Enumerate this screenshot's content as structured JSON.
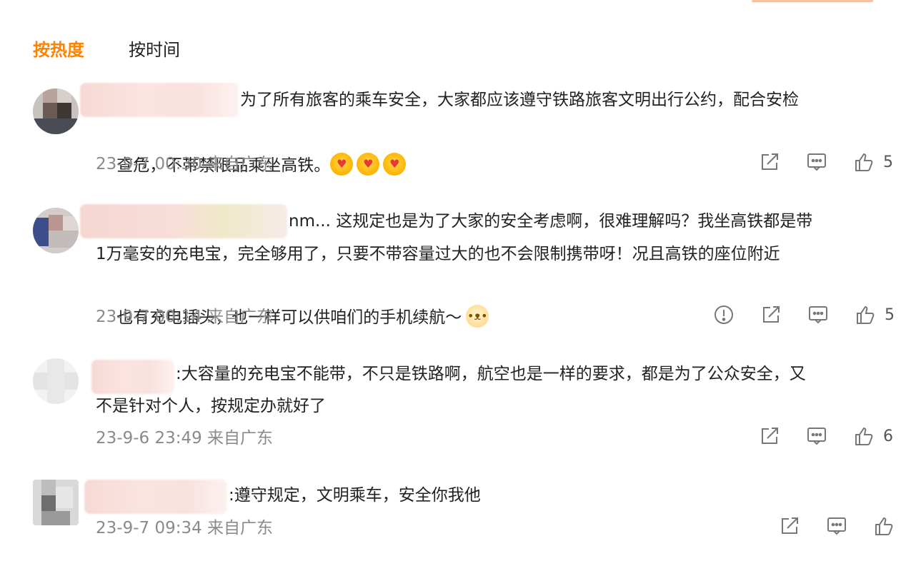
{
  "sort_tabs": [
    {
      "label": "按热度",
      "active": true
    },
    {
      "label": "按时间",
      "active": false
    }
  ],
  "colors": {
    "accent": "#ff8200",
    "meta": "#8a8a8a"
  },
  "comments": [
    {
      "lines": [
        "为了所有旅客的乘车安全，大家都应该遵守铁路旅客文明出行公约，配合安检",
        "查危，不带禁限品乘坐高铁。"
      ],
      "emojis": [
        "heart-eyes-emoji",
        "heart-eyes-emoji",
        "heart-eyes-emoji"
      ],
      "meta": "23-9-7 00:30 来自广东",
      "like_count": "5"
    },
    {
      "lines": [
        "nm... 这规定也是为了大家的安全考虑啊，很难理解吗？我坐高铁都是带",
        "1万毫安的充电宝，完全够用了，只要不带容量过大的也不会限制携带呀！况且高铁的座位附近",
        "也有充电插头，也一样可以供咱们的手机续航～"
      ],
      "emojis": [
        "dog-emoji"
      ],
      "meta": "23-9-7 00:14 来自广东",
      "like_count": "5"
    },
    {
      "lines": [
        ":大容量的充电宝不能带，不只是铁路啊，航空也是一样的要求，都是为了公众安全，又",
        "不是针对个人，按规定办就好了"
      ],
      "meta": "23-9-6 23:49 来自广东",
      "like_count": "6"
    },
    {
      "lines": [
        ":遵守规定，文明乘车，安全你我他"
      ],
      "meta": "23-9-7 09:34 来自广东",
      "like_count": ""
    }
  ]
}
